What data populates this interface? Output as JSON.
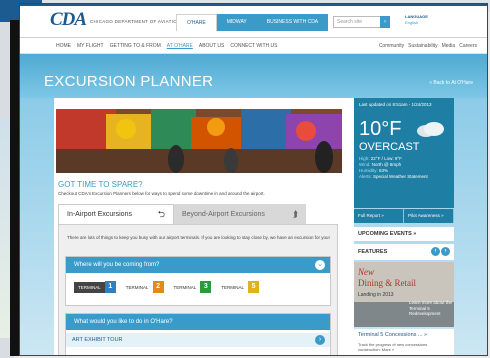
{
  "header": {
    "logo": "CDA",
    "logo_sub": "CHICAGO DEPARTMENT OF AVIATION",
    "tabs": [
      "O'HARE",
      "MIDWAY",
      "BUSINESS WITH CDA"
    ],
    "search_placeholder": "Search site",
    "language_label": "LANGUAGE",
    "language_value": "English"
  },
  "subnav": {
    "left": [
      "HOME",
      "MY FLIGHT",
      "GETTING TO & FROM",
      "AT O'HARE",
      "ABOUT US",
      "CONNECT WITH US"
    ],
    "right": [
      "Community",
      "Sustainability",
      "Media",
      "Careers"
    ]
  },
  "banner": {
    "title": "EXCURSION PLANNER",
    "back": "« Back to At O'Hare"
  },
  "main": {
    "heading": "GOT TIME TO SPARE?",
    "desc": "Checkout CDA's Excursion Planners below for ways to spend some downtime in and around the airport.",
    "tabs": [
      "In-Airport Excursions",
      "Beyond-Airport Excursions"
    ],
    "intro": "There are lots of things to keep you busy with our airport terminals. If you are looking to stay close by, we have an excursion for you!",
    "coming_from": "Where will you be coming from?",
    "terminal_word": "TERMINAL",
    "terminals": [
      "1",
      "2",
      "3",
      "5"
    ],
    "terminal_colors": [
      "#2f7fc1",
      "#e08a1e",
      "#2e9a3e",
      "#e0b21e"
    ],
    "what_heading": "What would you like to do in O'Hare?",
    "exhibit": "ART EXHIBIT TOUR"
  },
  "weather": {
    "updated": "Last updated on 8:51am - 1/24/2013",
    "temp": "10°F",
    "condition": "OVERCAST",
    "hl_key": "High:",
    "hl_val": "22°F / Low: 9°F",
    "wind_key": "Wind:",
    "wind_val": "North @ 8mph",
    "hum_key": "Humidity:",
    "hum_val": "63%",
    "alert_key": "Alerts:",
    "alert_val": "Special Weather Statement",
    "links": [
      "Full Report »",
      "Pilot Awareness »"
    ]
  },
  "sidebar": {
    "upcoming": "UPCOMING EVENTS »",
    "features": "FEATURES",
    "ad_new": "New",
    "ad_title": "Dining & Retail",
    "ad_landing": "Landing in 2013",
    "ad_more": "Learn more about the Terminal 5 Redevelopment",
    "t5_title": "Terminal 5 Concessions ... »",
    "t5_desc": "Track the progress of new concessions construction. More »"
  }
}
